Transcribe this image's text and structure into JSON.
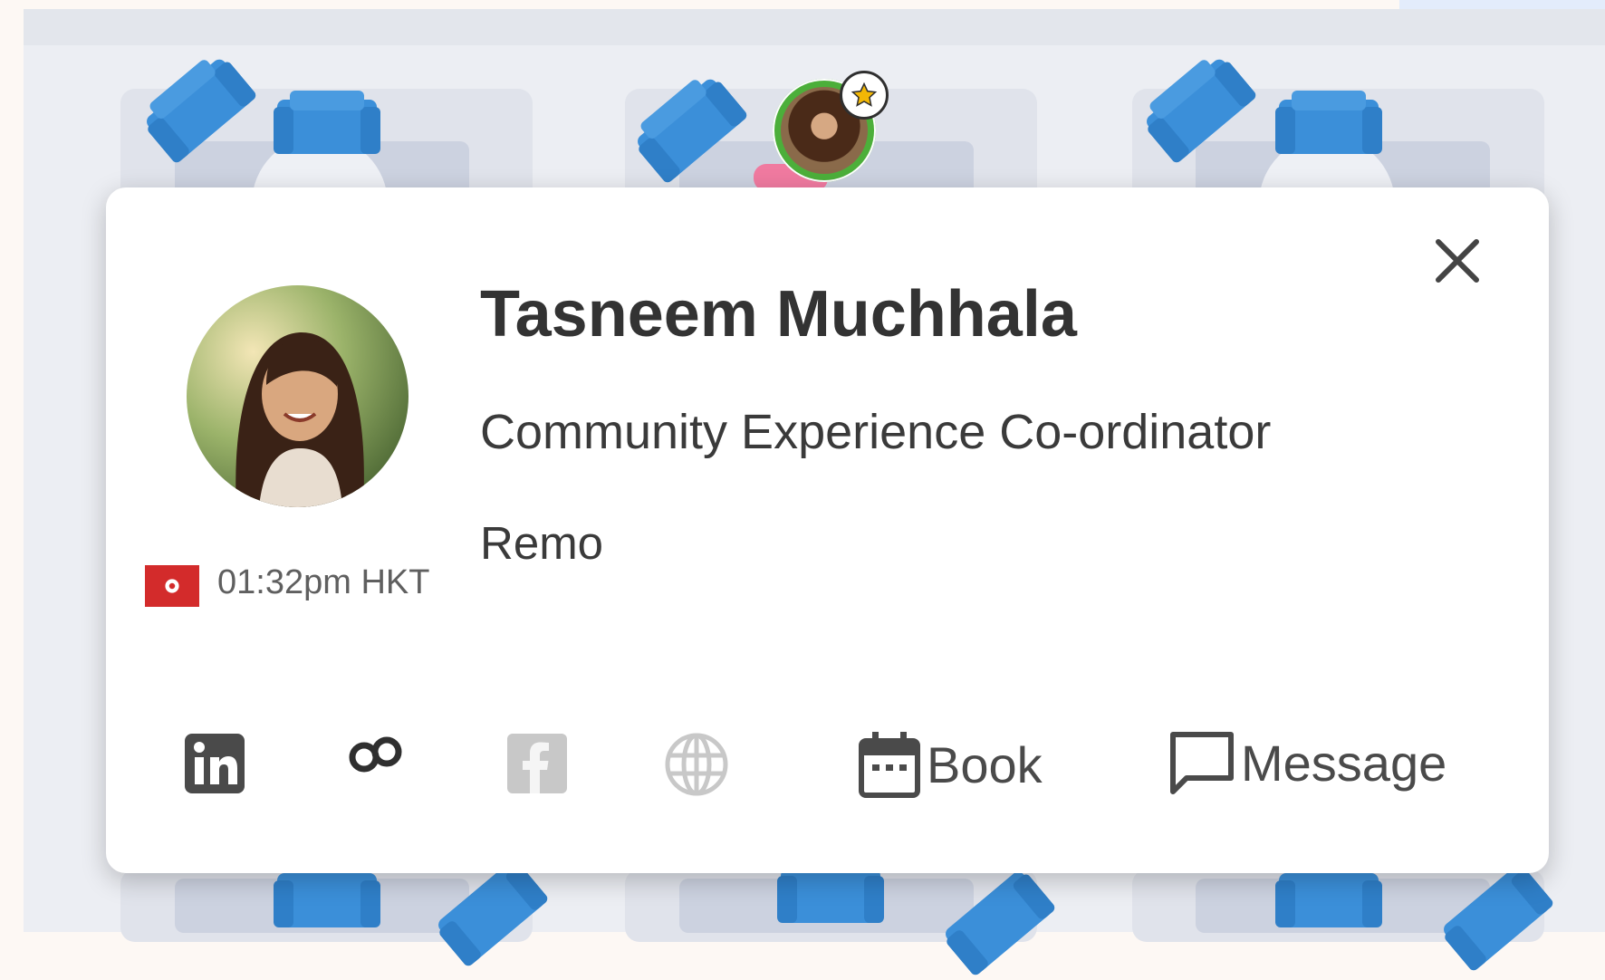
{
  "profile": {
    "name": "Tasneem Muchhala",
    "job_title": "Community Experience Co-ordinator",
    "company": "Remo",
    "local_time": "01:32pm HKT",
    "flag_icon": "hong-kong-flag-icon"
  },
  "actions": {
    "linkedin_icon": "linkedin-icon",
    "remo_icon": "remo-infinity-icon",
    "facebook_icon": "facebook-icon",
    "website_icon": "globe-icon",
    "book_label": "Book",
    "message_label": "Message"
  },
  "colors": {
    "chair_blue": "#3b8fd9",
    "popup_bg": "#ffffff",
    "floor_bg": "#eceef3",
    "avatar_ring": "#4caf3a",
    "flag_red": "#d32b2b"
  }
}
